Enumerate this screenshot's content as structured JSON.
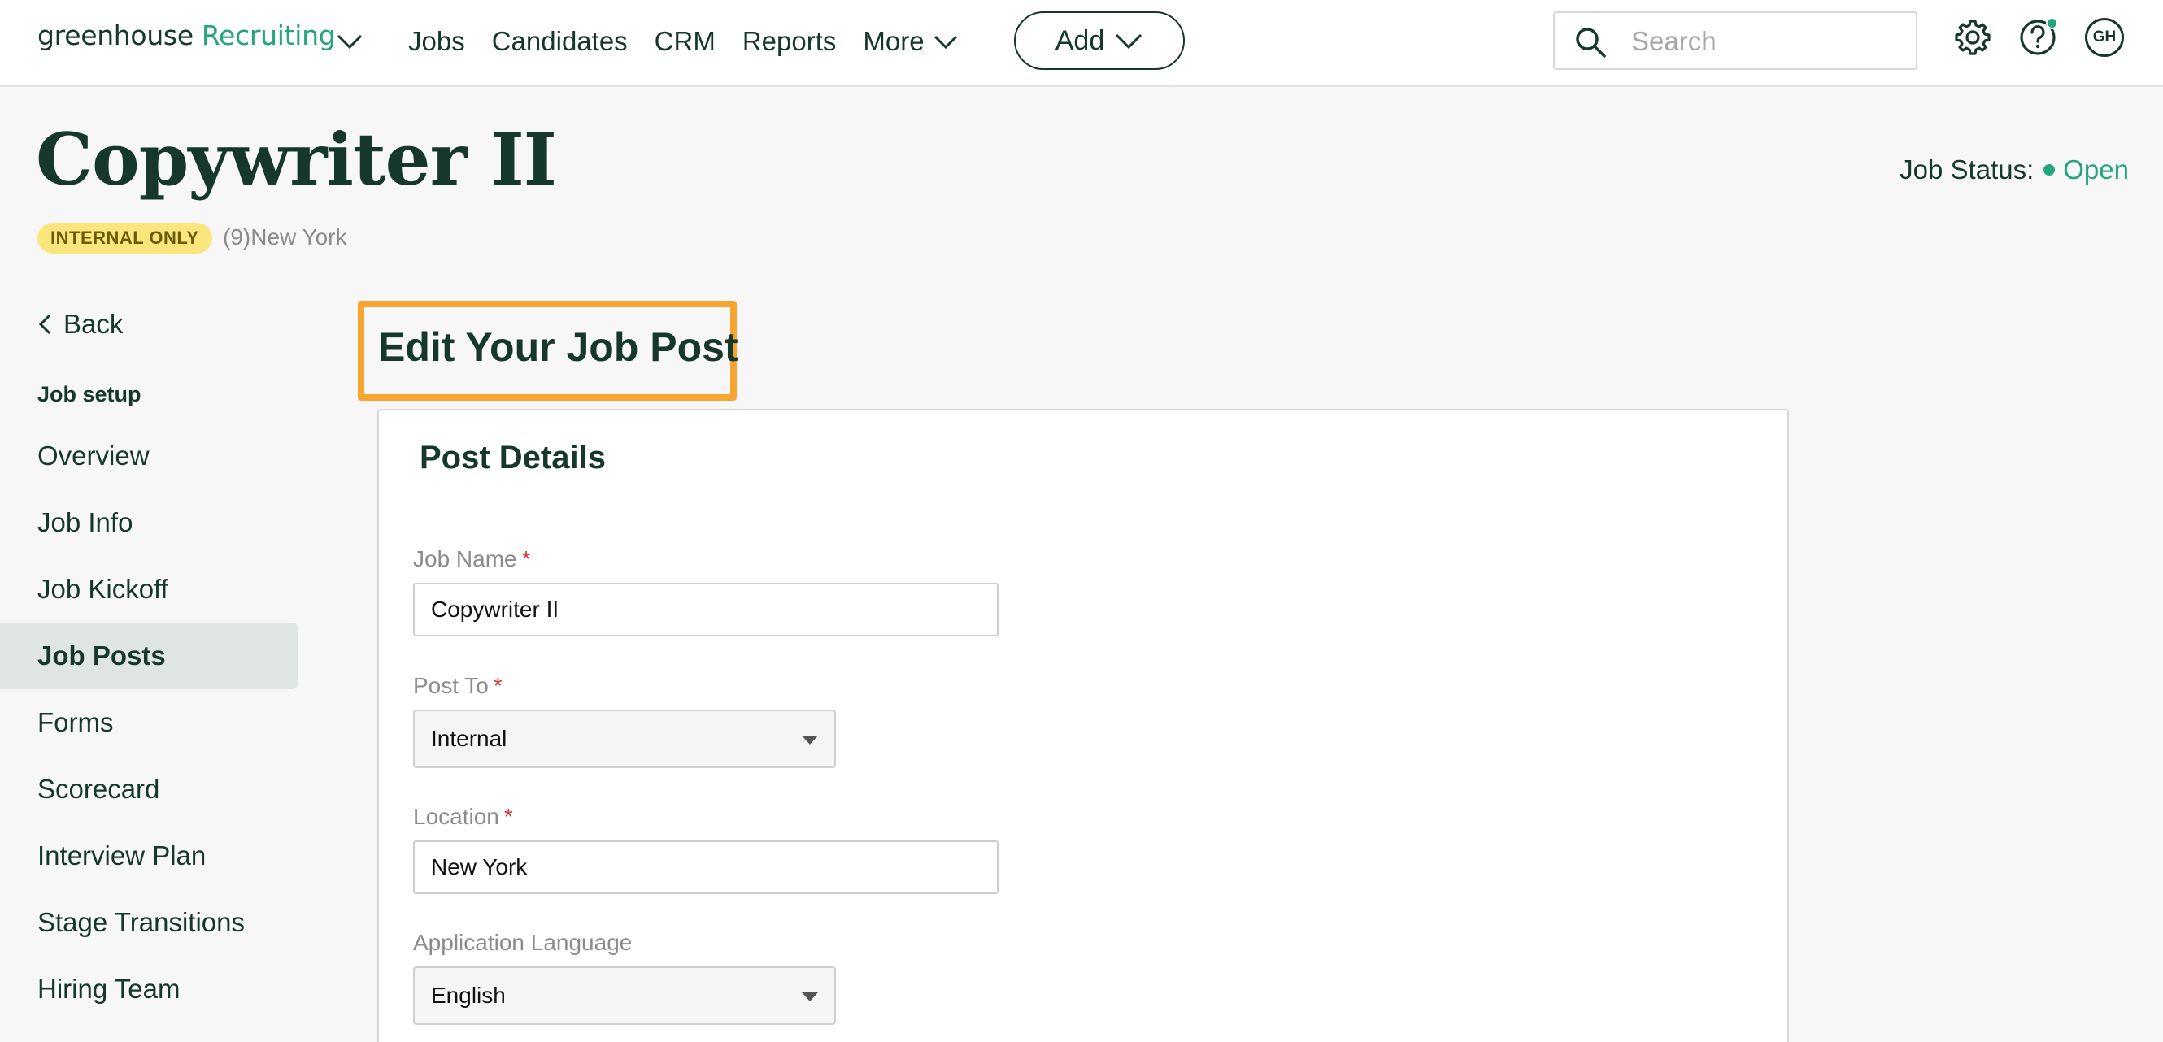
{
  "nav": {
    "logo_main": "greenhouse",
    "logo_product": "Recruiting",
    "links": [
      "Jobs",
      "Candidates",
      "CRM",
      "Reports"
    ],
    "more_label": "More",
    "add_label": "Add",
    "search_placeholder": "Search",
    "avatar_initials": "GH"
  },
  "header": {
    "title": "Copywriter II",
    "badge": "INTERNAL ONLY",
    "location_meta": "(9)New York",
    "status_label": "Job Status:",
    "status_value": "Open",
    "status_color": "#24a47f"
  },
  "sidebar": {
    "back_label": "Back",
    "heading": "Job setup",
    "items": [
      {
        "label": "Overview",
        "active": false
      },
      {
        "label": "Job Info",
        "active": false
      },
      {
        "label": "Job Kickoff",
        "active": false
      },
      {
        "label": "Job Posts",
        "active": true
      },
      {
        "label": "Forms",
        "active": false
      },
      {
        "label": "Scorecard",
        "active": false
      },
      {
        "label": "Interview Plan",
        "active": false
      },
      {
        "label": "Stage Transitions",
        "active": false
      },
      {
        "label": "Hiring Team",
        "active": false
      }
    ]
  },
  "main": {
    "title": "Edit Your Job Post",
    "highlight_color": "#f7a531",
    "card_title": "Post Details",
    "fields": {
      "job_name": {
        "label": "Job Name",
        "required_mark": "*",
        "value": "Copywriter II"
      },
      "post_to": {
        "label": "Post To",
        "required_mark": "*",
        "value": "Internal"
      },
      "location": {
        "label": "Location",
        "required_mark": "*",
        "value": "New York"
      },
      "application_language": {
        "label": "Application Language",
        "value": "English"
      }
    }
  }
}
